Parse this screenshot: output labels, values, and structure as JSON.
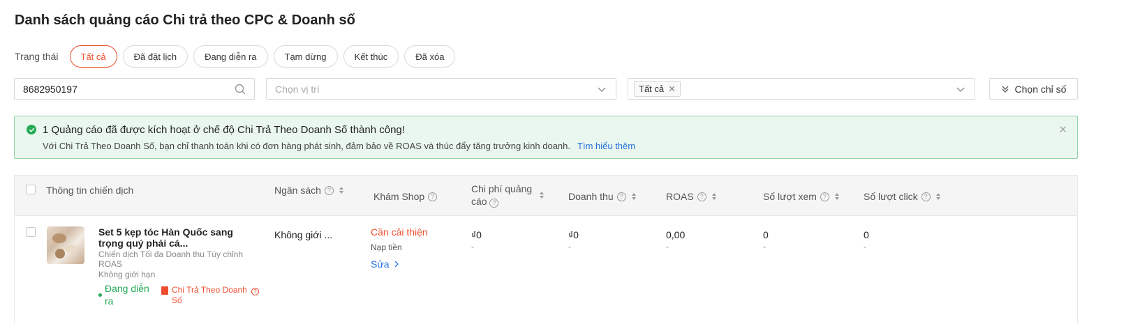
{
  "page": {
    "title": "Danh sách quảng cáo Chi trả theo CPC & Doanh số"
  },
  "status": {
    "label": "Trạng thái",
    "tabs": [
      {
        "label": "Tất cả",
        "active": true
      },
      {
        "label": "Đã đặt lịch"
      },
      {
        "label": "Đang diễn ra"
      },
      {
        "label": "Tạm dừng"
      },
      {
        "label": "Kết thúc"
      },
      {
        "label": "Đã xóa"
      }
    ]
  },
  "filters": {
    "search_value": "8682950197",
    "location_placeholder": "Chọn vị trí",
    "tag": "Tất cả",
    "metric_button": "Chọn chỉ số"
  },
  "alert": {
    "title": "1 Quảng cáo đã được kích hoạt ở chế độ Chi Trả Theo Doanh Số thành công!",
    "description": "Với Chi Trả Theo Doanh Số, bạn chỉ thanh toán khi có đơn hàng phát sinh, đảm bảo về ROAS và thúc đẩy tăng trưởng kinh doanh.",
    "link": "Tìm hiểu thêm",
    "close": "✕"
  },
  "table": {
    "headers": {
      "campaign": "Thông tin chiến dịch",
      "budget": "Ngân sách",
      "shop_explore": "Khám Shop",
      "ad_cost": "Chi phí quảng cáo",
      "revenue": "Doanh thu",
      "roas": "ROAS",
      "views": "Số lượt xem",
      "clicks": "Số lượt click"
    },
    "rows": [
      {
        "name": "Set 5 kẹp tóc Hàn Quốc sang trọng quý phái cá...",
        "campaign_type": "Chiến dịch Tối đa Doanh thu Tùy chỉnh ROAS",
        "budget_type": "Không giới hạn",
        "status": "Đang diễn ra",
        "badge": "Chi Trả Theo Doanh Số",
        "budget": "Không giới ...",
        "shop_explore": "Cần cải thiện",
        "shop_explore_action": "Nạp tiền",
        "edit": "Sửa",
        "ad_cost": "₫0",
        "ad_cost_sub": "-",
        "revenue": "₫0",
        "revenue_sub": "-",
        "roas": "0,00",
        "roas_sub": "-",
        "views": "0",
        "views_sub": "-",
        "clicks": "0",
        "clicks_sub": "-"
      }
    ]
  },
  "colors": {
    "accent": "#ee4d2d",
    "success": "#26aa57",
    "link": "#2673dd",
    "alert_bg": "#eaf7ee"
  }
}
